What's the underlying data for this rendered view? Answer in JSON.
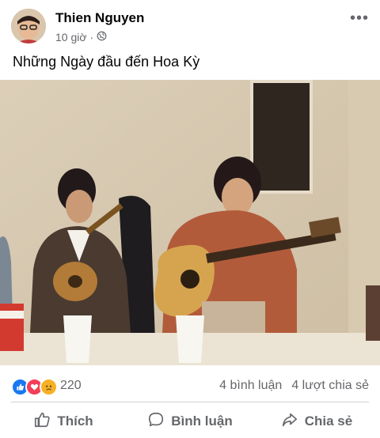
{
  "post": {
    "author": "Thien Nguyen",
    "time": "10 giờ",
    "separator": "·",
    "privacy_icon": "globe-icon",
    "text": "Những Ngày đầu đến Hoa Kỳ"
  },
  "reactions": {
    "icons": [
      "like-icon",
      "love-icon",
      "sad-icon"
    ],
    "count": "220",
    "comments": "4 bình luận",
    "shares": "4 lượt chia sẻ"
  },
  "actions": {
    "like": "Thích",
    "comment": "Bình luận",
    "share": "Chia sẻ"
  },
  "colors": {
    "like_blue": "#1877f2",
    "love_red": "#f33e58",
    "sad_yellow": "#f7b125",
    "secondary_text": "#65676b"
  }
}
